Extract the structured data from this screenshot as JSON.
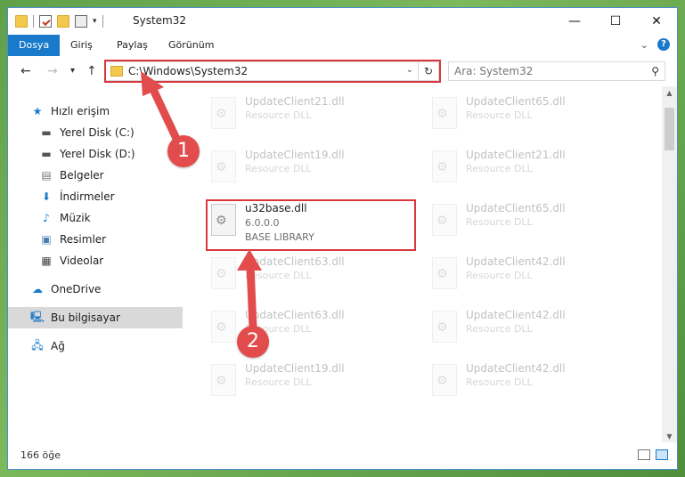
{
  "window": {
    "title": "System32",
    "controls": {
      "minimize": "—",
      "maximize": "☐",
      "close": "✕"
    }
  },
  "ribbon": {
    "tabs": [
      {
        "label": "Dosya",
        "active": true
      },
      {
        "label": "Giriş",
        "active": false
      },
      {
        "label": "Paylaş",
        "active": false
      },
      {
        "label": "Görünüm",
        "active": false
      }
    ],
    "help": "?"
  },
  "navigation": {
    "back": "←",
    "forward": "→",
    "recent": "▾",
    "up": "↑",
    "address": "C:\\Windows\\System32",
    "refresh": "↻",
    "search_placeholder": "Ara: System32"
  },
  "sidebar": {
    "items": [
      {
        "label": "Hızlı erişim",
        "icon": "star-icon"
      },
      {
        "label": "Yerel Disk (C:)",
        "icon": "drive-icon"
      },
      {
        "label": "Yerel Disk (D:)",
        "icon": "drive-icon"
      },
      {
        "label": "Belgeler",
        "icon": "documents-icon"
      },
      {
        "label": "İndirmeler",
        "icon": "download-icon"
      },
      {
        "label": "Müzik",
        "icon": "music-icon"
      },
      {
        "label": "Resimler",
        "icon": "pictures-icon"
      },
      {
        "label": "Videolar",
        "icon": "video-icon"
      },
      {
        "label": "OneDrive",
        "icon": "cloud-icon"
      },
      {
        "label": "Bu bilgisayar",
        "icon": "computer-icon",
        "selected": true
      },
      {
        "label": "Ağ",
        "icon": "network-icon"
      }
    ]
  },
  "files": {
    "left": [
      {
        "name": "UpdateClient21.dll",
        "type": "Resource DLL"
      },
      {
        "name": "UpdateClient19.dll",
        "type": "Resource DLL"
      },
      {
        "name": "u32base.dll",
        "version": "6.0.0.0",
        "type": "BASE LIBRARY"
      },
      {
        "name": "UpdateClient63.dll",
        "type": "Resource DLL"
      },
      {
        "name": "UpdateClient63.dll",
        "type": "Resource DLL"
      },
      {
        "name": "UpdateClient19.dll",
        "type": "Resource DLL"
      }
    ],
    "right": [
      {
        "name": "UpdateClient65.dll",
        "type": "Resource DLL"
      },
      {
        "name": "UpdateClient21.dll",
        "type": "Resource DLL"
      },
      {
        "name": "UpdateClient65.dll",
        "type": "Resource DLL"
      },
      {
        "name": "UpdateClient42.dll",
        "type": "Resource DLL"
      },
      {
        "name": "UpdateClient42.dll",
        "type": "Resource DLL"
      },
      {
        "name": "UpdateClient42.dll",
        "type": "Resource DLL"
      }
    ]
  },
  "status": {
    "count": "166 öğe"
  },
  "annotations": {
    "step1": "1",
    "step2": "2",
    "color": "#e24c4c"
  }
}
